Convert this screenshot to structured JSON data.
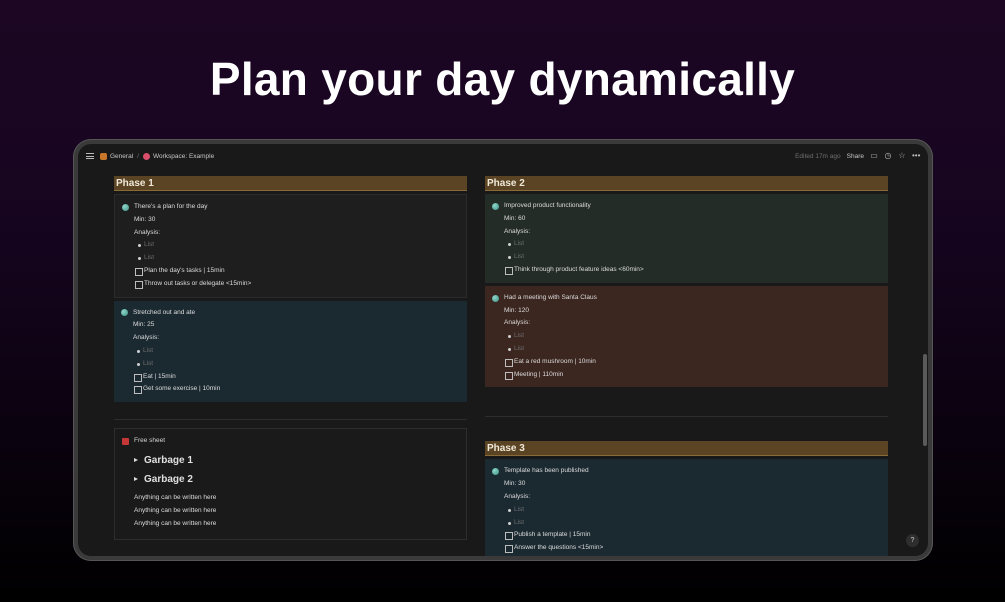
{
  "hero": {
    "title": "Plan your day dynamically"
  },
  "topbar": {
    "breadcrumb": [
      {
        "label": "General",
        "icon": "folder-icon",
        "color": "#c8772a"
      },
      {
        "label": "Workspace: Example",
        "icon": "workspace-icon",
        "color": "#d94f6b"
      }
    ],
    "edited": "Edited 17m ago",
    "share": "Share"
  },
  "phase1": {
    "title": "Phase 1",
    "cards": [
      {
        "title": "There's a plan for the day",
        "min": "Min: 30",
        "analysis": "Analysis:",
        "bullets": [
          "List",
          "List"
        ],
        "tasks": [
          "Plan the day's tasks | 15min",
          "Throw out tasks or delegate <15min>"
        ]
      },
      {
        "title": "Stretched out and ate",
        "min": "Min: 25",
        "analysis": "Analysis:",
        "bullets": [
          "List",
          "List"
        ],
        "tasks": [
          "Eat | 15min",
          "Get some exercise | 10min"
        ]
      }
    ]
  },
  "phase2": {
    "title": "Phase 2",
    "cards": [
      {
        "title": "Improved product functionality",
        "min": "Min: 60",
        "analysis": "Analysis:",
        "bullets": [
          "List",
          "List"
        ],
        "tasks": [
          "Think through product feature ideas <60min>"
        ]
      },
      {
        "title": "Had a meeting with Santa Claus",
        "min": "Min: 120",
        "analysis": "Analysis:",
        "bullets": [
          "List",
          "List"
        ],
        "tasks": [
          "Eat a red mushroom | 10min",
          "Meeting | 110min"
        ]
      }
    ]
  },
  "phase3": {
    "title": "Phase 3",
    "cards": [
      {
        "title": "Template has been published",
        "min": "Min: 30",
        "analysis": "Analysis:",
        "bullets": [
          "List",
          "List"
        ],
        "tasks": [
          "Publish a template | 15min",
          "Answer the questions <15min>"
        ]
      }
    ]
  },
  "free_sheet": {
    "title": "Free sheet",
    "toggles": [
      "Garbage 1",
      "Garbage 2"
    ],
    "lines": [
      "Anything can be written here",
      "Anything can be written here",
      "Anything can be written here"
    ]
  },
  "help": "?"
}
